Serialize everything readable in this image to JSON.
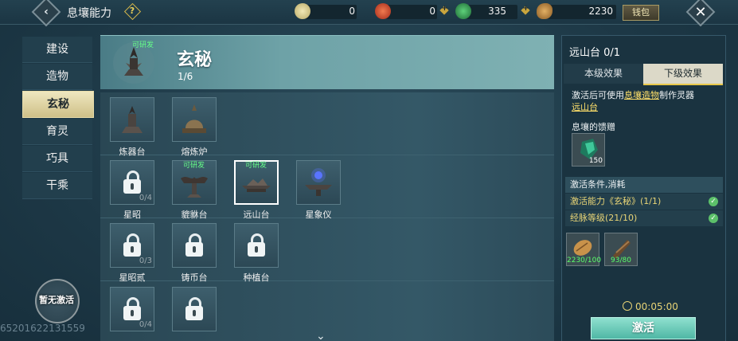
{
  "topbar": {
    "title": "息壤能力",
    "help_icon": "question-icon",
    "currencies": [
      {
        "icon": "jade-coin-icon",
        "value": "0"
      },
      {
        "icon": "red-orb-icon",
        "value": "0"
      },
      {
        "icon": "green-jade-icon",
        "value": "335"
      },
      {
        "icon": "gourd-icon",
        "value": "2230"
      }
    ],
    "wallet_label": "钱包"
  },
  "nav": {
    "items": [
      {
        "label": "建设",
        "active": false
      },
      {
        "label": "造物",
        "active": false
      },
      {
        "label": "玄秘",
        "active": true
      },
      {
        "label": "育灵",
        "active": false
      },
      {
        "label": "巧具",
        "active": false
      },
      {
        "label": "干乘",
        "active": false
      }
    ],
    "no_activation_label": "暂无激活"
  },
  "watermark": "65201622131559",
  "category": {
    "title": "玄秘",
    "count": "1/6",
    "tag": "可研发"
  },
  "nodes": [
    {
      "name": "炼器台",
      "locked": false,
      "tag": "",
      "frac": "",
      "icon": "forge-table-icon"
    },
    {
      "name": "熔炼炉",
      "locked": false,
      "tag": "",
      "frac": "",
      "icon": "smelting-furnace-icon"
    },
    {
      "name": "星昭",
      "locked": true,
      "tag": "",
      "frac": "0/4",
      "icon": "lock-icon"
    },
    {
      "name": "貔貅台",
      "locked": false,
      "tag": "可研发",
      "frac": "",
      "icon": "pixiu-platform-icon"
    },
    {
      "name": "远山台",
      "locked": false,
      "tag": "可研发",
      "frac": "",
      "icon": "mountain-platform-icon",
      "selected": true
    },
    {
      "name": "星象仪",
      "locked": false,
      "tag": "",
      "frac": "",
      "icon": "astrolabe-icon"
    },
    {
      "name": "星昭贰",
      "locked": true,
      "tag": "",
      "frac": "0/3",
      "icon": "lock-icon"
    },
    {
      "name": "铸币台",
      "locked": true,
      "tag": "",
      "frac": "",
      "icon": "lock-icon"
    },
    {
      "name": "种植台",
      "locked": true,
      "tag": "",
      "frac": "",
      "icon": "lock-icon"
    },
    {
      "name": "",
      "locked": true,
      "tag": "",
      "frac": "0/4",
      "icon": "lock-icon"
    },
    {
      "name": "",
      "locked": true,
      "tag": "",
      "frac": "",
      "icon": "lock-icon"
    }
  ],
  "detail": {
    "title": "远山台 0/1",
    "tab_current": "本级效果",
    "tab_next": "下级效果",
    "desc_prefix": "激活后可使用",
    "desc_link1": "息壤造物",
    "desc_mid": "制作灵器",
    "desc_link2": "远山台",
    "material_label": "息壤的馈赠",
    "material_qty": "150",
    "conditions_header": "激活条件,消耗",
    "conditions": [
      {
        "text": "激活能力《玄秘》(1/1)",
        "met": true
      },
      {
        "text": "经脉等级(21/10)",
        "met": true
      }
    ],
    "costs": [
      {
        "icon": "gourd-icon",
        "qty": "2230/100"
      },
      {
        "icon": "wood-icon",
        "qty": "93/80"
      }
    ],
    "timer": "00:05:00",
    "activate_label": "激活"
  },
  "colors": {
    "accent": "#e8c84a",
    "green": "#5aff6a",
    "teal_button": "#6fcfbd"
  }
}
